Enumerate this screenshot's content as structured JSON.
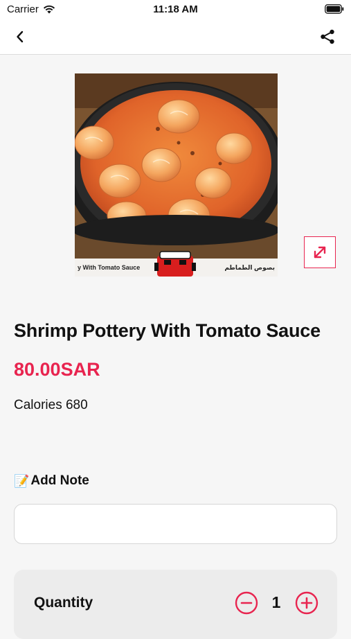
{
  "status_bar": {
    "carrier": "Carrier",
    "time": "11:18 AM"
  },
  "nav": {
    "back_icon": "chevron-left-icon",
    "share_icon": "share-icon"
  },
  "product": {
    "image_caption_en": "y With Tomato Sauce",
    "image_caption_ar": "بصوص الطماطم",
    "title": "Shrimp Pottery With Tomato Sauce",
    "price": "80.00SAR",
    "calories": "Calories 680"
  },
  "note": {
    "label": "Add Note",
    "icon": "📝",
    "value": "",
    "placeholder": ""
  },
  "quantity": {
    "label": "Quantity",
    "value": "1"
  },
  "colors": {
    "accent": "#e8244f",
    "background": "#f6f6f6"
  }
}
